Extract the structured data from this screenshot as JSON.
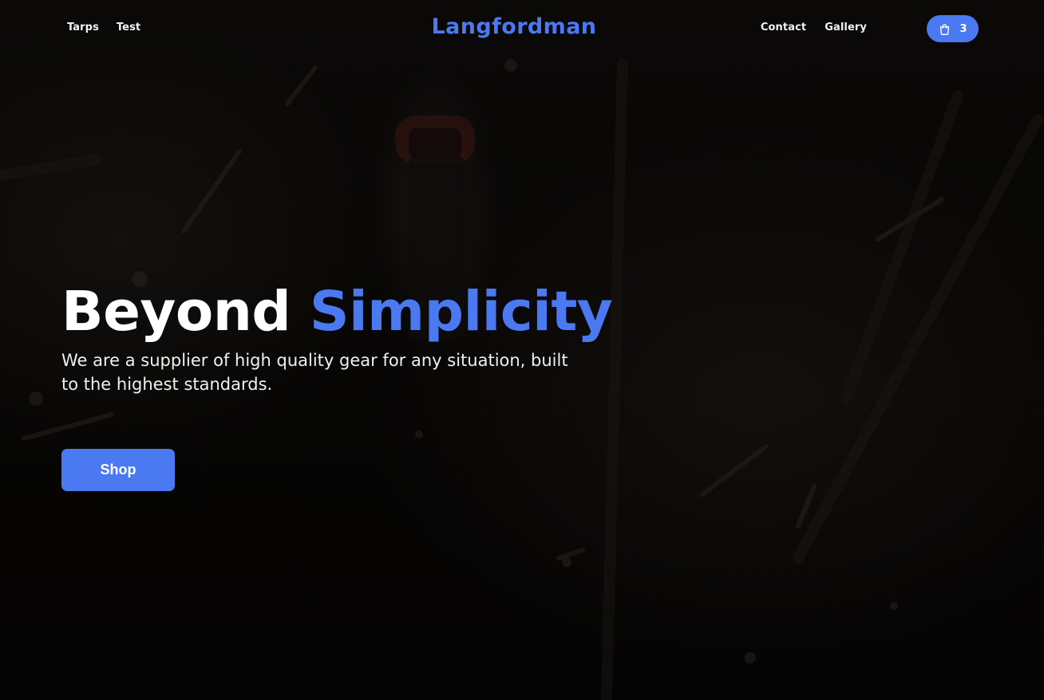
{
  "nav": {
    "left_links": [
      {
        "label": "Tarps"
      },
      {
        "label": "Test"
      }
    ],
    "right_links": [
      {
        "label": "Contact"
      },
      {
        "label": "Gallery"
      }
    ],
    "cart": {
      "count": "3",
      "icon": "shopping-bag-icon"
    }
  },
  "brand": {
    "name": "Langfordman"
  },
  "hero": {
    "title_word_1": "Beyond",
    "title_word_2": "Simplicity",
    "subtitle": "We are a supplier of high quality gear for any situation, built to the highest standards.",
    "cta_label": "Shop"
  },
  "colors": {
    "accent": "#4a79f2",
    "background": "#050505",
    "text": "#ffffff"
  }
}
